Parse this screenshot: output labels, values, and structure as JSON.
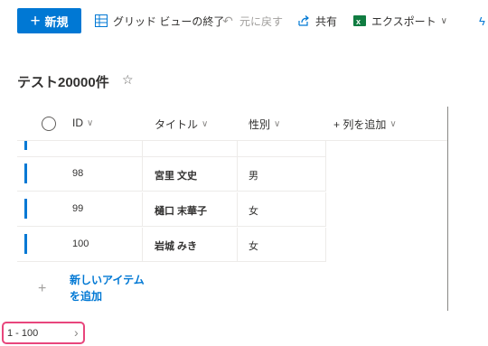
{
  "commandbar": {
    "new_label": "新規",
    "exit_grid_label": "グリッド ビューの終了",
    "undo_label": "元に戻す",
    "share_label": "共有",
    "export_label": "エクスポート"
  },
  "list": {
    "title": "テスト20000件",
    "favorite_icon": "star-icon"
  },
  "columns": {
    "id": "ID",
    "title": "タイトル",
    "gender": "性別",
    "add_column": "+ 列を追加"
  },
  "rows": [
    {
      "id": "98",
      "title": "宮里 文史",
      "gender": "男"
    },
    {
      "id": "99",
      "title": "樋口 末華子",
      "gender": "女"
    },
    {
      "id": "100",
      "title": "岩城 みき",
      "gender": "女"
    }
  ],
  "add_item_label": "新しいアイテムを追加",
  "pager": {
    "range": "1 - 100"
  },
  "colors": {
    "accent": "#0078d4",
    "highlight": "#e8467c"
  }
}
